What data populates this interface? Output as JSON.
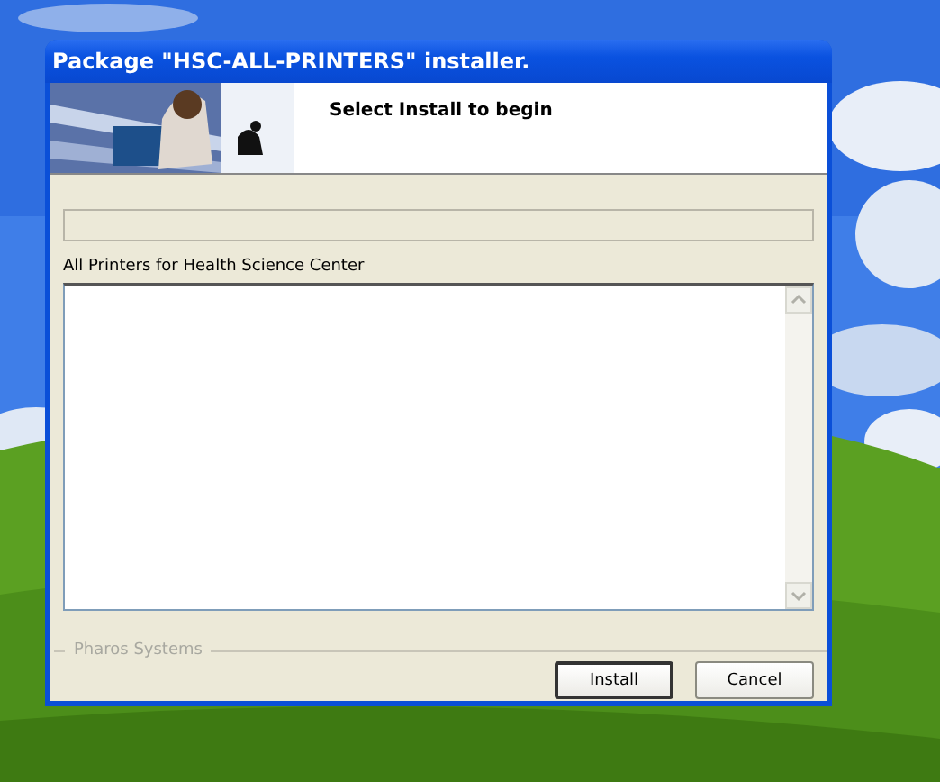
{
  "window": {
    "title": "Package \"HSC-ALL-PRINTERS\" installer."
  },
  "header": {
    "message": "Select Install to begin"
  },
  "progress": {
    "level": 0
  },
  "description": {
    "label": "All Printers for Health Science Center",
    "text_area": {
      "disabled": false
    }
  },
  "group": {
    "label": "Pharos Systems"
  },
  "buttons": [
    {
      "label": "Install",
      "default": true
    },
    {
      "label": "Cancel",
      "default": false
    }
  ]
}
